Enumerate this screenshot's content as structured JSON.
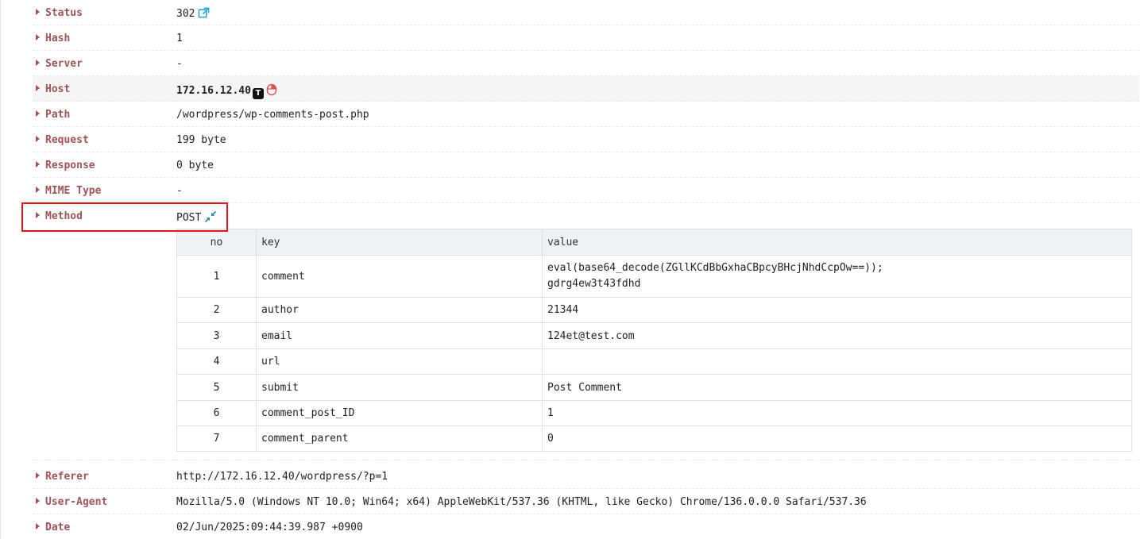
{
  "fields": {
    "status": {
      "label": "Status",
      "value": "302"
    },
    "hash": {
      "label": "Hash",
      "value": "1"
    },
    "server": {
      "label": "Server",
      "value": "-"
    },
    "host": {
      "label": "Host",
      "value": "172.16.12.40",
      "badge": "T"
    },
    "path": {
      "label": "Path",
      "value": "/wordpress/wp-comments-post.php"
    },
    "request": {
      "label": "Request",
      "value": "199 byte"
    },
    "response": {
      "label": "Response",
      "value": "0 byte"
    },
    "mime_type": {
      "label": "MIME Type",
      "value": "-"
    },
    "method": {
      "label": "Method",
      "value": "POST"
    },
    "referer": {
      "label": "Referer",
      "value": "http://172.16.12.40/wordpress/?p=1"
    },
    "user_agent": {
      "label": "User-Agent",
      "value": "Mozilla/5.0 (Windows NT 10.0; Win64; x64) AppleWebKit/537.36 (KHTML, like Gecko) Chrome/136.0.0.0 Safari/537.36"
    },
    "date": {
      "label": "Date",
      "value": "02/Jun/2025:09:44:39.987 +0900"
    }
  },
  "params_table": {
    "headers": {
      "no": "no",
      "key": "key",
      "value": "value"
    },
    "rows": [
      {
        "no": "1",
        "key": "comment",
        "value_line1": "eval(base64_decode(ZGllKCdBbGxhaCBpcyBHcjNhdCcpOw==));",
        "value_line2": "gdrg4ew3t43fdhd"
      },
      {
        "no": "2",
        "key": "author",
        "value": "21344"
      },
      {
        "no": "3",
        "key": "email",
        "value": "124et@test.com"
      },
      {
        "no": "4",
        "key": "url",
        "value": ""
      },
      {
        "no": "5",
        "key": "submit",
        "value": "Post Comment"
      },
      {
        "no": "6",
        "key": "comment_post_ID",
        "value": "1"
      },
      {
        "no": "7",
        "key": "comment_parent",
        "value": "0"
      }
    ]
  },
  "icons": {
    "status_link": "external-link-icon",
    "host_mouse": "mouse-icon",
    "method_collapse": "collapse-arrows-icon"
  },
  "colors": {
    "label": "#a0545a",
    "highlight_box": "#e8141b",
    "link_icon": "#2a9fd6",
    "collapse_icon": "#2a8fa0",
    "mouse_icon": "#d9534f"
  }
}
